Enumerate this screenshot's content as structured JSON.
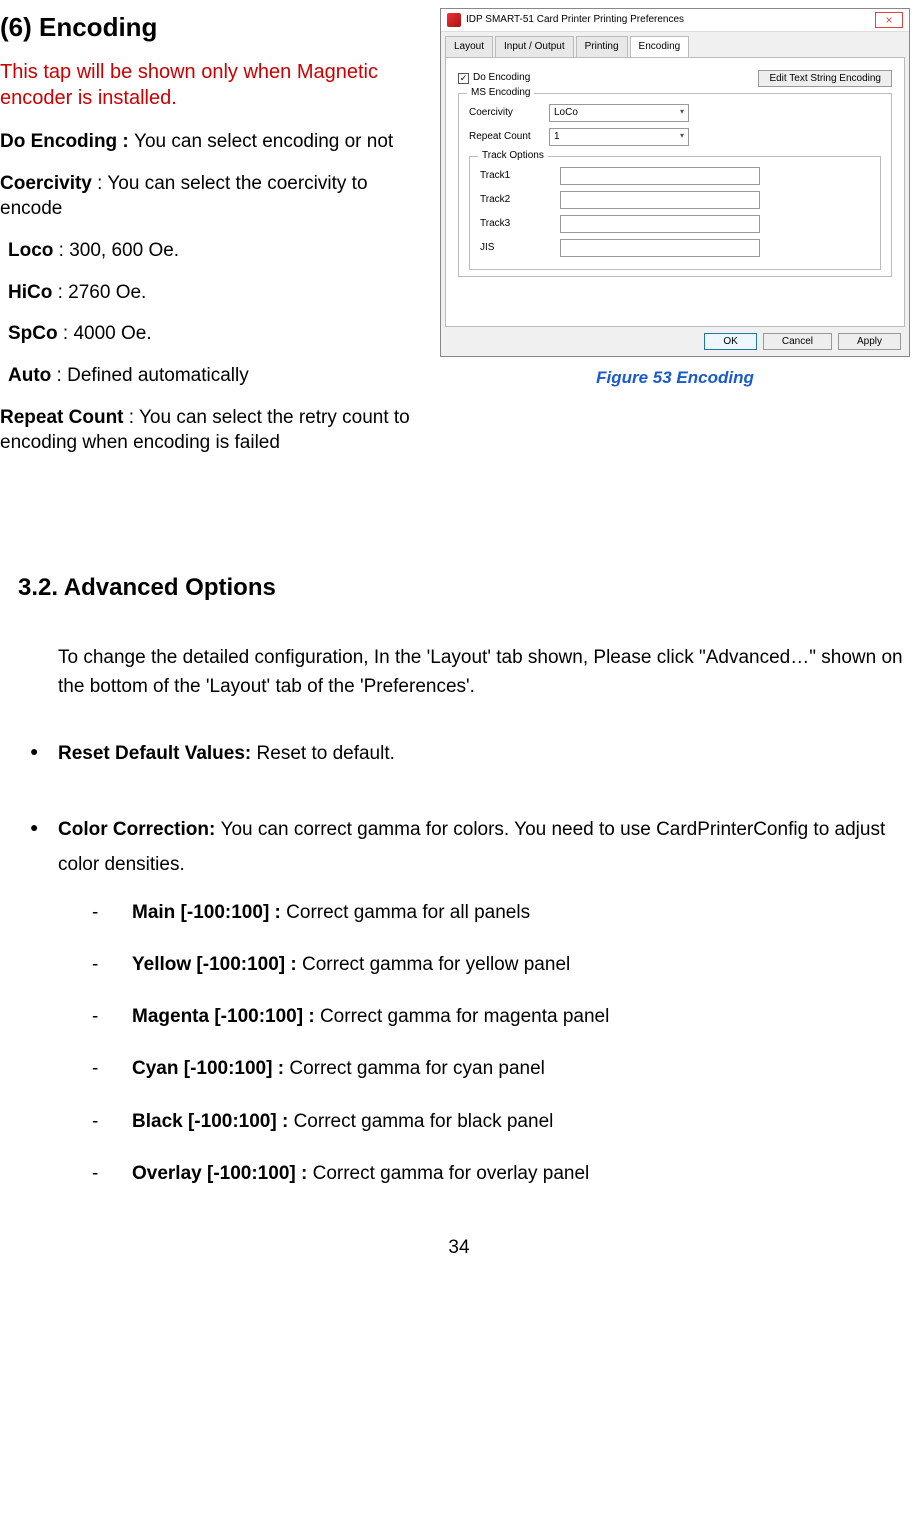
{
  "heading_encoding": "(6) Encoding",
  "red_note": "This tap will be shown only when Magnetic encoder is installed.",
  "do_encoding_label": "Do Encoding : ",
  "do_encoding_desc": "You can select encoding or not",
  "coercivity_label": "Coercivity",
  "coercivity_desc": " : You can select the coercivity to encode",
  "loco_label": "Loco",
  "loco_desc": " : 300, 600 Oe.",
  "hico_label": "HiCo",
  "hico_desc": " : 2760 Oe.",
  "spco_label": "SpCo",
  "spco_desc": " : 4000 Oe.",
  "auto_label": "Auto",
  "auto_desc": " : Defined automatically",
  "repeat_label": "Repeat Count",
  "repeat_desc": " : You can select the retry count to encoding when encoding is failed",
  "figure_caption": "Figure 53 Encoding",
  "section_3_2": "3.2. Advanced Options",
  "adv_intro": "To change the detailed configuration, In the 'Layout' tab shown, Please click \"Advanced…\" shown on the bottom of the 'Layout' tab of the 'Preferences'.",
  "reset_label": "Reset Default Values: ",
  "reset_desc": "Reset to default.",
  "color_corr_label": "Color Correction: ",
  "color_corr_desc": "You can correct gamma for colors. You need to use CardPrinterConfig to adjust color densities.",
  "cc_items": [
    {
      "label": "Main [-100:100] : ",
      "desc": "Correct gamma for all panels"
    },
    {
      "label": "Yellow [-100:100] : ",
      "desc": "Correct gamma for yellow panel"
    },
    {
      "label": "Magenta [-100:100] : ",
      "desc": "Correct gamma for magenta panel"
    },
    {
      "label": "Cyan [-100:100] : ",
      "desc": "Correct gamma for cyan panel"
    },
    {
      "label": "Black [-100:100] : ",
      "desc": "Correct gamma for black panel"
    },
    {
      "label": "Overlay [-100:100] : ",
      "desc": "Correct gamma for overlay panel"
    }
  ],
  "page_number": "34",
  "dialog": {
    "title": "IDP SMART-51 Card Printer Printing Preferences",
    "tabs": [
      "Layout",
      "Input / Output",
      "Printing",
      "Encoding"
    ],
    "active_tab": "Encoding",
    "do_encoding_chk": "Do Encoding",
    "edit_btn": "Edit Text String Encoding",
    "group_ms": "MS Encoding",
    "coercivity_lbl": "Coercivity",
    "coercivity_val": "LoCo",
    "repeat_lbl": "Repeat Count",
    "repeat_val": "1",
    "group_track": "Track Options",
    "tracks": [
      "Track1",
      "Track2",
      "Track3",
      "JIS"
    ],
    "ok": "OK",
    "cancel": "Cancel",
    "apply": "Apply"
  }
}
